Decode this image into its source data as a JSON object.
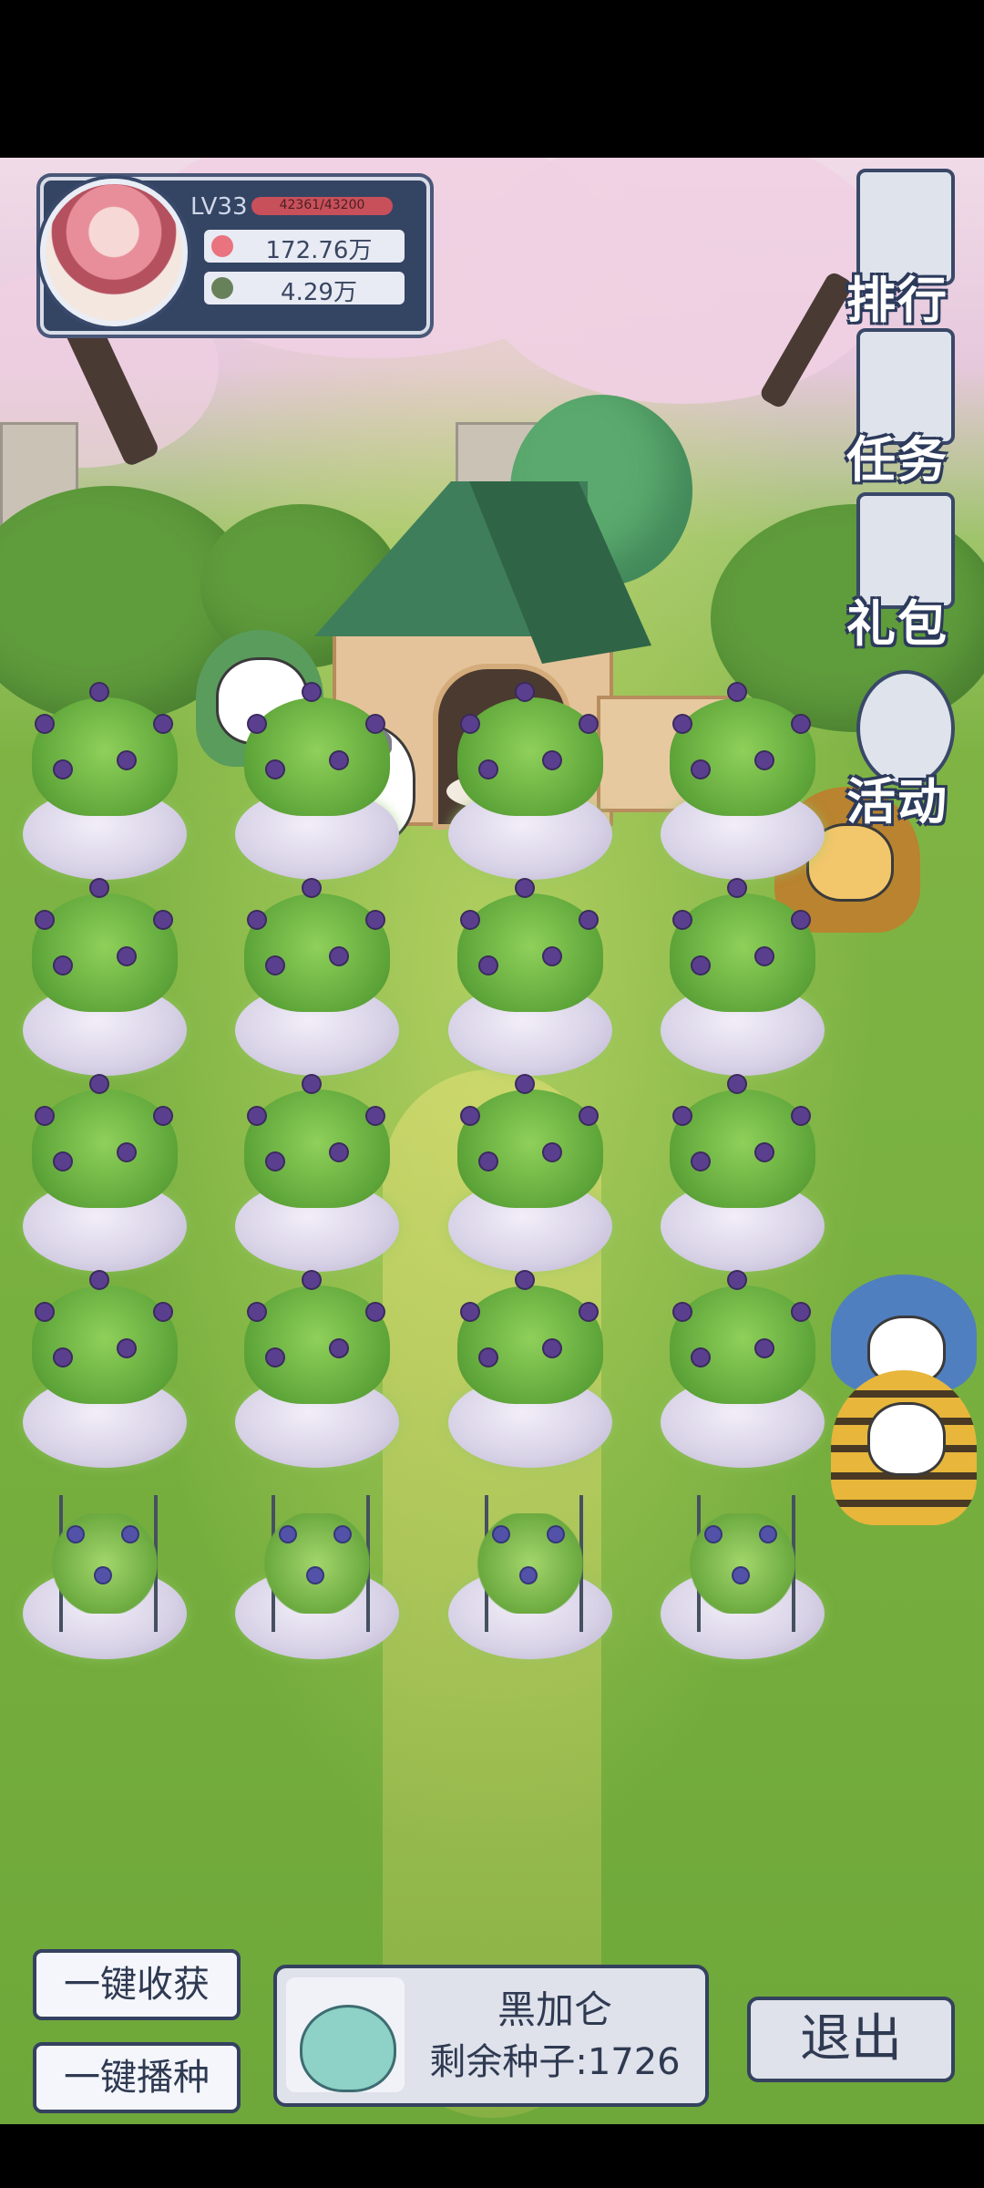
{
  "profile": {
    "level": "LV33",
    "exp": "42361/43200",
    "hearts": "172.76万",
    "leaves": "4.29万"
  },
  "menu": [
    {
      "label": "排行",
      "icon": "ranking-icon"
    },
    {
      "label": "任务",
      "icon": "task-clipboard-icon"
    },
    {
      "label": "礼包",
      "icon": "gift-box-icon"
    },
    {
      "label": "活动",
      "icon": "event-balloon-icon"
    }
  ],
  "plots": {
    "rows": 5,
    "columns": 4,
    "crop_rows_1_to_4": "purple-flower-bush",
    "crop_row_5": "blackcurrant-trellis"
  },
  "actions": {
    "harvest_all": "一键收获",
    "sow_all": "一键播种"
  },
  "seed": {
    "name": "黑加仑",
    "remaining": "剩余种子:1726"
  },
  "exit": "退出",
  "colors": {
    "panel_navy": "#34415f",
    "exp_bar": "#c8505a",
    "grass": "#7fb445",
    "blossom": "#efd0e3"
  }
}
